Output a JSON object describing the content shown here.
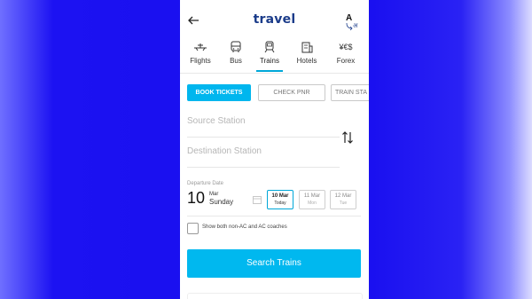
{
  "header": {
    "logo_text": "travel",
    "lang_primary": "A",
    "lang_secondary": "अ"
  },
  "categories": [
    {
      "label": "Flights",
      "icon": "plane-icon"
    },
    {
      "label": "Bus",
      "icon": "bus-icon"
    },
    {
      "label": "Trains",
      "icon": "train-icon",
      "active": true
    },
    {
      "label": "Hotels",
      "icon": "hotel-icon"
    },
    {
      "label": "Forex",
      "icon": "forex-icon",
      "glyph": "¥€$"
    }
  ],
  "tabs": [
    {
      "label": "BOOK TICKETS",
      "active": true
    },
    {
      "label": "CHECK PNR",
      "active": false
    },
    {
      "label": "TRAIN STA",
      "active": false
    }
  ],
  "form": {
    "source_placeholder": "Source Station",
    "destination_placeholder": "Destination Station",
    "departure_label": "Departure Date",
    "day": "10",
    "month": "Mar",
    "weekday": "Sunday"
  },
  "date_chips": [
    {
      "date": "10 Mar",
      "sub": "Today",
      "active": true
    },
    {
      "date": "11 Mar",
      "sub": "Mon",
      "active": false
    },
    {
      "date": "12 Mar",
      "sub": "Tue",
      "active": false
    }
  ],
  "option": {
    "label": "Show both non-AC and AC coaches",
    "checked": false
  },
  "actions": {
    "search_label": "Search Trains"
  },
  "colors": {
    "accent": "#00b8ef",
    "brand": "#1b3c8a",
    "background": "#1a10f0"
  }
}
